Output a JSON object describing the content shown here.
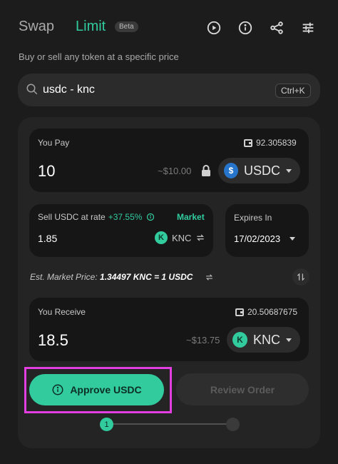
{
  "header": {
    "tab_swap": "Swap",
    "tab_limit": "Limit",
    "beta_badge": "Beta",
    "subtitle": "Buy or sell any token at a specific price",
    "icons": [
      "play-circle-icon",
      "info-icon",
      "share-icon",
      "settings-sliders-icon"
    ]
  },
  "search": {
    "value": "usdc - knc",
    "shortcut": "Ctrl+K"
  },
  "you_pay": {
    "label": "You Pay",
    "balance": "92.305839",
    "amount": "10",
    "usd_value": "~$10.00",
    "token": "USDC"
  },
  "rate": {
    "label": "Sell USDC at rate",
    "change": "+37.55%",
    "market_link": "Market",
    "value": "1.85",
    "token": "KNC"
  },
  "expires": {
    "label": "Expires In",
    "value": "17/02/2023"
  },
  "est_market": {
    "label": "Est. Market Price:",
    "value": "1.34497 KNC = 1 USDC"
  },
  "you_receive": {
    "label": "You Receive",
    "balance": "20.50687675",
    "amount": "18.5",
    "usd_value": "~$13.75",
    "token": "KNC"
  },
  "actions": {
    "approve_label": "Approve USDC",
    "review_label": "Review Order"
  },
  "steps": {
    "current": "1"
  },
  "colors": {
    "accent": "#31cb9e",
    "background": "#1c1c1c",
    "panel": "#242424",
    "card": "#161616",
    "highlight": "#e23ee0",
    "usdc": "#2775ca"
  }
}
